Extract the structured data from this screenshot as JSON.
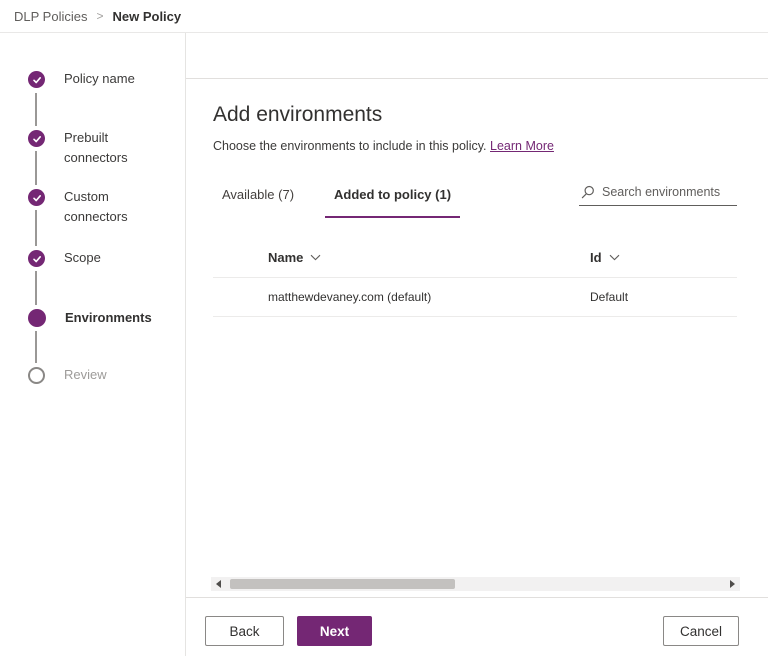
{
  "breadcrumb": {
    "parent": "DLP Policies",
    "separator": ">",
    "current": "New Policy"
  },
  "sidebar": {
    "steps": [
      {
        "label": "Policy name",
        "state": "complete"
      },
      {
        "label": "Prebuilt connectors",
        "state": "complete"
      },
      {
        "label": "Custom connectors",
        "state": "complete"
      },
      {
        "label": "Scope",
        "state": "complete"
      },
      {
        "label": "Environments",
        "state": "current"
      },
      {
        "label": "Review",
        "state": "upcoming"
      }
    ]
  },
  "main": {
    "title": "Add environments",
    "subtitle": "Choose the environments to include in this policy.",
    "learn_more_label": "Learn More",
    "tabs": [
      {
        "label": "Available (7)",
        "selected": false
      },
      {
        "label": "Added to policy (1)",
        "selected": true
      }
    ],
    "search": {
      "placeholder": "Search environments"
    },
    "table": {
      "columns": [
        {
          "label": "Name"
        },
        {
          "label": "Id"
        }
      ],
      "rows": [
        {
          "name": "matthewdevaney.com (default)",
          "id": "Default"
        }
      ]
    }
  },
  "footer": {
    "back_label": "Back",
    "next_label": "Next",
    "cancel_label": "Cancel"
  },
  "icons": {
    "search": "magnifier",
    "sort": "chevron-down",
    "step_complete": "checkmark",
    "scroll_left": "triangle-left",
    "scroll_right": "triangle-right"
  },
  "colors": {
    "accent": "#742774",
    "text_primary": "#323130",
    "text_secondary": "#605e5c",
    "border_light": "#edebe9",
    "button_border": "#8a8886",
    "scroll_track": "#f2f1f1",
    "scroll_thumb": "#c3c1bf"
  }
}
